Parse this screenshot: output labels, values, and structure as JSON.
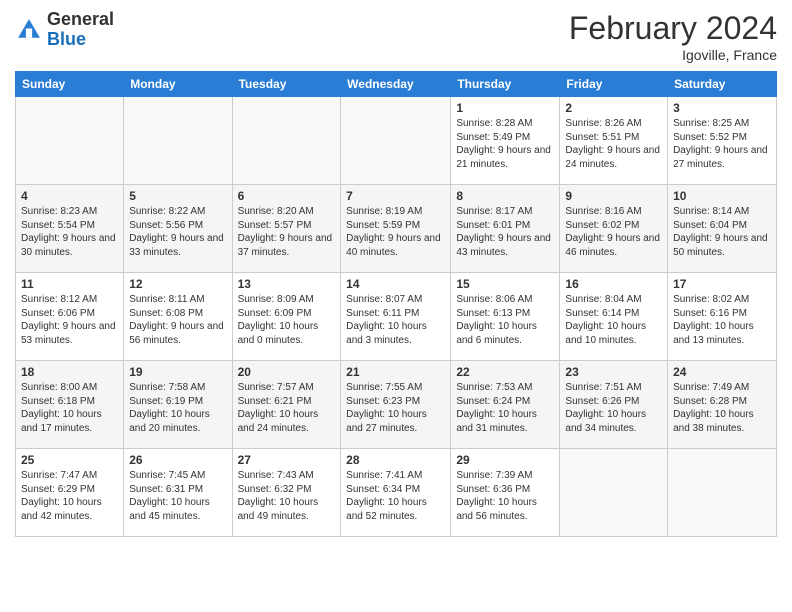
{
  "header": {
    "logo_general": "General",
    "logo_blue": "Blue",
    "month_year": "February 2024",
    "location": "Igoville, France"
  },
  "days_of_week": [
    "Sunday",
    "Monday",
    "Tuesday",
    "Wednesday",
    "Thursday",
    "Friday",
    "Saturday"
  ],
  "weeks": [
    [
      {
        "day": "",
        "info": ""
      },
      {
        "day": "",
        "info": ""
      },
      {
        "day": "",
        "info": ""
      },
      {
        "day": "",
        "info": ""
      },
      {
        "day": "1",
        "info": "Sunrise: 8:28 AM\nSunset: 5:49 PM\nDaylight: 9 hours and 21 minutes."
      },
      {
        "day": "2",
        "info": "Sunrise: 8:26 AM\nSunset: 5:51 PM\nDaylight: 9 hours and 24 minutes."
      },
      {
        "day": "3",
        "info": "Sunrise: 8:25 AM\nSunset: 5:52 PM\nDaylight: 9 hours and 27 minutes."
      }
    ],
    [
      {
        "day": "4",
        "info": "Sunrise: 8:23 AM\nSunset: 5:54 PM\nDaylight: 9 hours and 30 minutes."
      },
      {
        "day": "5",
        "info": "Sunrise: 8:22 AM\nSunset: 5:56 PM\nDaylight: 9 hours and 33 minutes."
      },
      {
        "day": "6",
        "info": "Sunrise: 8:20 AM\nSunset: 5:57 PM\nDaylight: 9 hours and 37 minutes."
      },
      {
        "day": "7",
        "info": "Sunrise: 8:19 AM\nSunset: 5:59 PM\nDaylight: 9 hours and 40 minutes."
      },
      {
        "day": "8",
        "info": "Sunrise: 8:17 AM\nSunset: 6:01 PM\nDaylight: 9 hours and 43 minutes."
      },
      {
        "day": "9",
        "info": "Sunrise: 8:16 AM\nSunset: 6:02 PM\nDaylight: 9 hours and 46 minutes."
      },
      {
        "day": "10",
        "info": "Sunrise: 8:14 AM\nSunset: 6:04 PM\nDaylight: 9 hours and 50 minutes."
      }
    ],
    [
      {
        "day": "11",
        "info": "Sunrise: 8:12 AM\nSunset: 6:06 PM\nDaylight: 9 hours and 53 minutes."
      },
      {
        "day": "12",
        "info": "Sunrise: 8:11 AM\nSunset: 6:08 PM\nDaylight: 9 hours and 56 minutes."
      },
      {
        "day": "13",
        "info": "Sunrise: 8:09 AM\nSunset: 6:09 PM\nDaylight: 10 hours and 0 minutes."
      },
      {
        "day": "14",
        "info": "Sunrise: 8:07 AM\nSunset: 6:11 PM\nDaylight: 10 hours and 3 minutes."
      },
      {
        "day": "15",
        "info": "Sunrise: 8:06 AM\nSunset: 6:13 PM\nDaylight: 10 hours and 6 minutes."
      },
      {
        "day": "16",
        "info": "Sunrise: 8:04 AM\nSunset: 6:14 PM\nDaylight: 10 hours and 10 minutes."
      },
      {
        "day": "17",
        "info": "Sunrise: 8:02 AM\nSunset: 6:16 PM\nDaylight: 10 hours and 13 minutes."
      }
    ],
    [
      {
        "day": "18",
        "info": "Sunrise: 8:00 AM\nSunset: 6:18 PM\nDaylight: 10 hours and 17 minutes."
      },
      {
        "day": "19",
        "info": "Sunrise: 7:58 AM\nSunset: 6:19 PM\nDaylight: 10 hours and 20 minutes."
      },
      {
        "day": "20",
        "info": "Sunrise: 7:57 AM\nSunset: 6:21 PM\nDaylight: 10 hours and 24 minutes."
      },
      {
        "day": "21",
        "info": "Sunrise: 7:55 AM\nSunset: 6:23 PM\nDaylight: 10 hours and 27 minutes."
      },
      {
        "day": "22",
        "info": "Sunrise: 7:53 AM\nSunset: 6:24 PM\nDaylight: 10 hours and 31 minutes."
      },
      {
        "day": "23",
        "info": "Sunrise: 7:51 AM\nSunset: 6:26 PM\nDaylight: 10 hours and 34 minutes."
      },
      {
        "day": "24",
        "info": "Sunrise: 7:49 AM\nSunset: 6:28 PM\nDaylight: 10 hours and 38 minutes."
      }
    ],
    [
      {
        "day": "25",
        "info": "Sunrise: 7:47 AM\nSunset: 6:29 PM\nDaylight: 10 hours and 42 minutes."
      },
      {
        "day": "26",
        "info": "Sunrise: 7:45 AM\nSunset: 6:31 PM\nDaylight: 10 hours and 45 minutes."
      },
      {
        "day": "27",
        "info": "Sunrise: 7:43 AM\nSunset: 6:32 PM\nDaylight: 10 hours and 49 minutes."
      },
      {
        "day": "28",
        "info": "Sunrise: 7:41 AM\nSunset: 6:34 PM\nDaylight: 10 hours and 52 minutes."
      },
      {
        "day": "29",
        "info": "Sunrise: 7:39 AM\nSunset: 6:36 PM\nDaylight: 10 hours and 56 minutes."
      },
      {
        "day": "",
        "info": ""
      },
      {
        "day": "",
        "info": ""
      }
    ]
  ]
}
